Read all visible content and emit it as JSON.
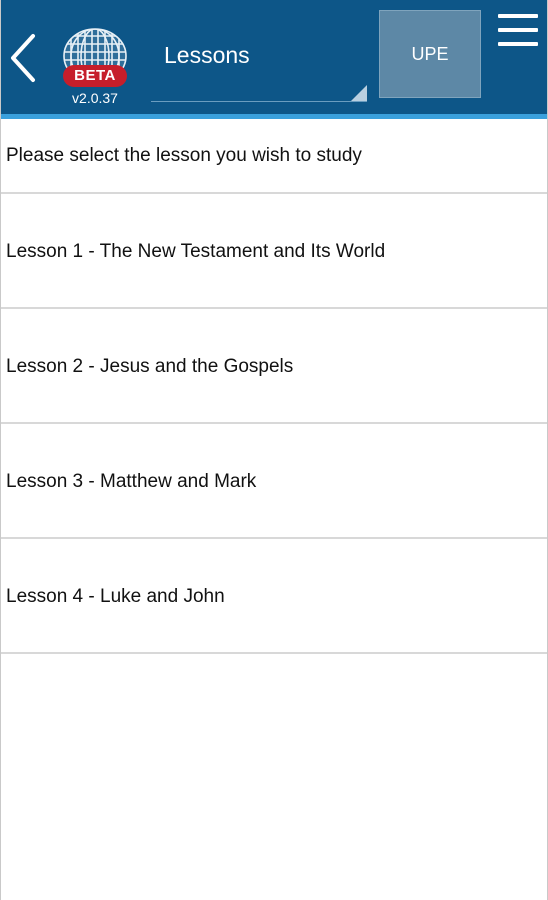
{
  "header": {
    "back_icon": "chevron-left-icon",
    "logo": {
      "icon": "globe-icon",
      "badge": "BETA",
      "version": "v2.0.37"
    },
    "title": "Lessons",
    "upe_label": "UPE",
    "menu_icon": "hamburger-menu-icon",
    "colors": {
      "bar": "#0d5688",
      "accent": "#3aa0dc",
      "badge": "#c61e2b",
      "upe_button": "#5d88a6"
    }
  },
  "content": {
    "prompt": "Please select the lesson you wish to study",
    "lessons": [
      {
        "label": "Lesson 1 - The New Testament and Its World"
      },
      {
        "label": "Lesson 2 - Jesus and the Gospels"
      },
      {
        "label": "Lesson 3 - Matthew and Mark"
      },
      {
        "label": "Lesson 4 - Luke and John"
      }
    ]
  }
}
